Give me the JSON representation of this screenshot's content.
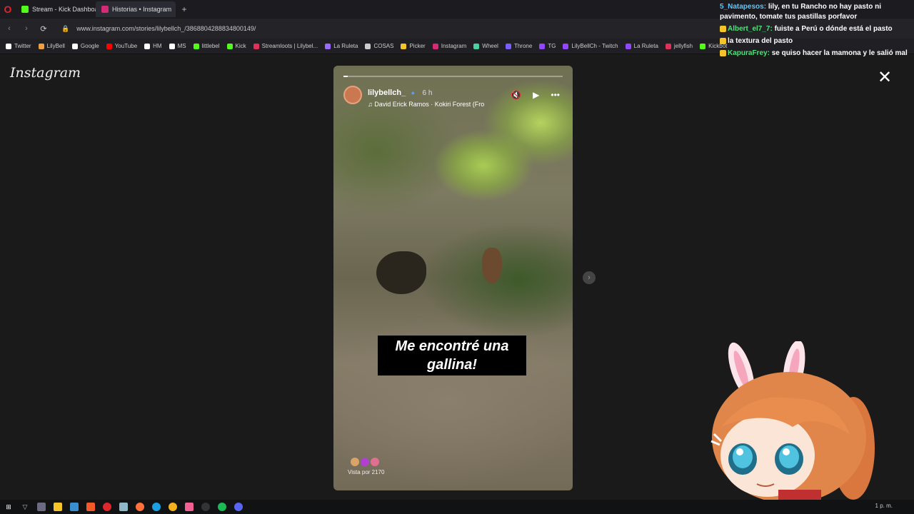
{
  "browser": {
    "tabs": [
      {
        "label": "Stream - Kick Dashboard",
        "color": "#53fc18"
      },
      {
        "label": "Historias • Instagram",
        "color": "#d62976"
      }
    ],
    "new_tab": "+",
    "url": "www.instagram.com/stories/lilybellch_/3868804288834800149/",
    "bookmarks": [
      {
        "label": "Twitter",
        "color": "#ffffff"
      },
      {
        "label": "LilyBell",
        "color": "#f0a040"
      },
      {
        "label": "Google",
        "color": "#ffffff"
      },
      {
        "label": "YouTube",
        "color": "#ff0000"
      },
      {
        "label": "HM",
        "color": "#ffffff"
      },
      {
        "label": "MS",
        "color": "#ffffff"
      },
      {
        "label": "littlebel",
        "color": "#53fc18"
      },
      {
        "label": "Kick",
        "color": "#53fc18"
      },
      {
        "label": "Streamloots | Lilybel...",
        "color": "#e0305a"
      },
      {
        "label": "La Ruleta",
        "color": "#9b6bff"
      },
      {
        "label": "COSAS",
        "color": "#cccccc"
      },
      {
        "label": "Picker",
        "color": "#f5c42a"
      },
      {
        "label": "Instagram",
        "color": "#d62976"
      },
      {
        "label": "Wheel",
        "color": "#4ad0a0"
      },
      {
        "label": "Throne",
        "color": "#7a5cff"
      },
      {
        "label": "TG",
        "color": "#9146ff"
      },
      {
        "label": "LilyBellCh - Twitch",
        "color": "#9146ff"
      },
      {
        "label": "La Ruleta",
        "color": "#9146ff"
      },
      {
        "label": "jellyfish",
        "color": "#e0305a"
      },
      {
        "label": "Kickbot",
        "color": "#53fc18"
      }
    ]
  },
  "instagram": {
    "logo": "Instagram",
    "close": "✕",
    "story": {
      "username": "lilybellch_",
      "time": "6 h",
      "song": "David Erick Ramos · Kokiri Forest (Fro",
      "caption_line1": "Me encontré una",
      "caption_line2": "gallina!",
      "viewers": "Vista por 2170",
      "progress_fraction": 0.02
    }
  },
  "chat": [
    {
      "user": "5_Natapesos:",
      "user_color": "blue",
      "text": "lily, en tu Rancho no hay pasto ni pavimento, tomate tus pastillas porfavor"
    },
    {
      "user": "Albert_el7_7:",
      "user_color": "green",
      "text": "fuiste a Perú o dónde está el pasto"
    },
    {
      "user": "",
      "user_color": "red",
      "text": "la textura del pasto"
    },
    {
      "user": "KapuraFrey:",
      "user_color": "green",
      "text": "se quiso hacer la mamona y le salió mal"
    }
  ],
  "taskbar": {
    "clock": "1 p. m."
  }
}
